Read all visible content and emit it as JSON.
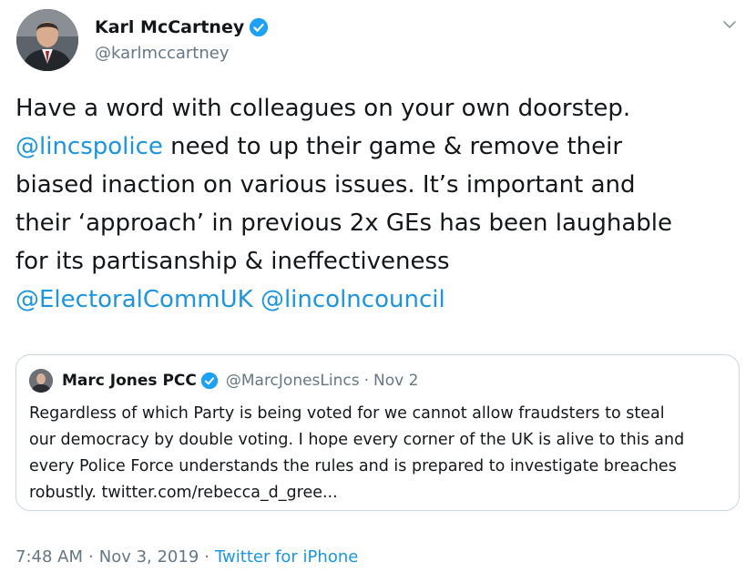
{
  "author": {
    "name": "Karl McCartney",
    "handle": "@karlmccartney",
    "verified_icon": "verified-badge-icon",
    "avatar_icon": "profile-photo"
  },
  "tweet": {
    "lines": [
      [
        {
          "text": "Have a word with colleagues on your own doorstep.",
          "link": false
        }
      ],
      [
        {
          "text": "@lincspolice",
          "link": true
        },
        {
          "text": " need to up their game & remove their",
          "link": false
        }
      ],
      [
        {
          "text": "biased inaction on various issues. It’s important and",
          "link": false
        }
      ],
      [
        {
          "text": "their ‘approach’ in previous 2x GEs has been laughable",
          "link": false
        }
      ],
      [
        {
          "text": "for its partisanship & ineffectiveness",
          "link": false
        }
      ],
      [
        {
          "text": "@ElectoralCommUK",
          "link": true
        },
        {
          "text": " ",
          "link": false
        },
        {
          "text": "@lincolncouncil",
          "link": true
        }
      ]
    ]
  },
  "quoted": {
    "name": "Marc Jones PCC",
    "handle": "@MarcJonesLincs",
    "separator": "·",
    "date": "Nov 2",
    "lines": [
      "Regardless of which Party is being voted for we cannot allow fraudsters to steal",
      "our democracy by double voting. I hope every corner of the UK is alive to this and",
      "every Police Force understands the rules and is prepared to investigate breaches",
      "robustly. twitter.com/rebecca_d_gree..."
    ]
  },
  "meta": {
    "time": "7:48 AM",
    "separator": "·",
    "date": "Nov 3, 2019",
    "source": "Twitter for iPhone"
  },
  "colors": {
    "link": "#1b95e0",
    "secondary_text": "#657786",
    "verified": "#1da1f2",
    "border": "#ccd6dd"
  }
}
